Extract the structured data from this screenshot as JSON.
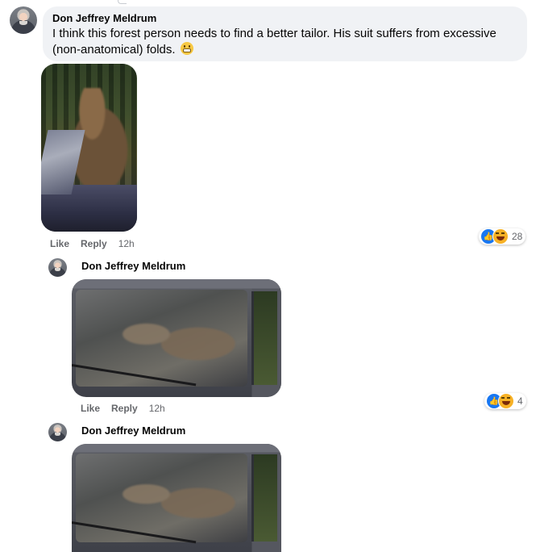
{
  "comment": {
    "author": "Don Jeffrey Meldrum",
    "text": "I think this forest person needs to find a better tailor. His suit suffers from excessive (non-anatomical) folds.",
    "emoji": "grimacing-face-emoji",
    "actions": {
      "like": "Like",
      "reply": "Reply",
      "time": "12h"
    },
    "reactions": {
      "types": [
        "like",
        "haha"
      ],
      "count": "28"
    }
  },
  "replies": [
    {
      "author": "Don Jeffrey Meldrum",
      "actions": {
        "like": "Like",
        "reply": "Reply",
        "time": "12h"
      },
      "reactions": {
        "types": [
          "like",
          "haha"
        ],
        "count": "4"
      }
    },
    {
      "author": "Don Jeffrey Meldrum"
    }
  ],
  "colors": {
    "bubble": "#f0f2f5",
    "meta": "#65676b",
    "like": "#1877f2",
    "haha": "#f7b125"
  }
}
